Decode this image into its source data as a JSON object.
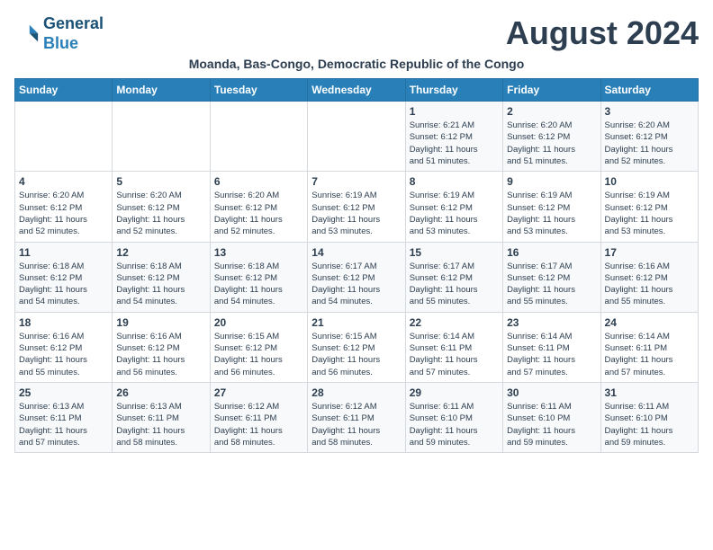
{
  "header": {
    "logo_line1": "General",
    "logo_line2": "Blue",
    "month_title": "August 2024",
    "subtitle": "Moanda, Bas-Congo, Democratic Republic of the Congo"
  },
  "days_of_week": [
    "Sunday",
    "Monday",
    "Tuesday",
    "Wednesday",
    "Thursday",
    "Friday",
    "Saturday"
  ],
  "weeks": [
    [
      {
        "day": "",
        "info": ""
      },
      {
        "day": "",
        "info": ""
      },
      {
        "day": "",
        "info": ""
      },
      {
        "day": "",
        "info": ""
      },
      {
        "day": "1",
        "info": "Sunrise: 6:21 AM\nSunset: 6:12 PM\nDaylight: 11 hours\nand 51 minutes."
      },
      {
        "day": "2",
        "info": "Sunrise: 6:20 AM\nSunset: 6:12 PM\nDaylight: 11 hours\nand 51 minutes."
      },
      {
        "day": "3",
        "info": "Sunrise: 6:20 AM\nSunset: 6:12 PM\nDaylight: 11 hours\nand 52 minutes."
      }
    ],
    [
      {
        "day": "4",
        "info": "Sunrise: 6:20 AM\nSunset: 6:12 PM\nDaylight: 11 hours\nand 52 minutes."
      },
      {
        "day": "5",
        "info": "Sunrise: 6:20 AM\nSunset: 6:12 PM\nDaylight: 11 hours\nand 52 minutes."
      },
      {
        "day": "6",
        "info": "Sunrise: 6:20 AM\nSunset: 6:12 PM\nDaylight: 11 hours\nand 52 minutes."
      },
      {
        "day": "7",
        "info": "Sunrise: 6:19 AM\nSunset: 6:12 PM\nDaylight: 11 hours\nand 53 minutes."
      },
      {
        "day": "8",
        "info": "Sunrise: 6:19 AM\nSunset: 6:12 PM\nDaylight: 11 hours\nand 53 minutes."
      },
      {
        "day": "9",
        "info": "Sunrise: 6:19 AM\nSunset: 6:12 PM\nDaylight: 11 hours\nand 53 minutes."
      },
      {
        "day": "10",
        "info": "Sunrise: 6:19 AM\nSunset: 6:12 PM\nDaylight: 11 hours\nand 53 minutes."
      }
    ],
    [
      {
        "day": "11",
        "info": "Sunrise: 6:18 AM\nSunset: 6:12 PM\nDaylight: 11 hours\nand 54 minutes."
      },
      {
        "day": "12",
        "info": "Sunrise: 6:18 AM\nSunset: 6:12 PM\nDaylight: 11 hours\nand 54 minutes."
      },
      {
        "day": "13",
        "info": "Sunrise: 6:18 AM\nSunset: 6:12 PM\nDaylight: 11 hours\nand 54 minutes."
      },
      {
        "day": "14",
        "info": "Sunrise: 6:17 AM\nSunset: 6:12 PM\nDaylight: 11 hours\nand 54 minutes."
      },
      {
        "day": "15",
        "info": "Sunrise: 6:17 AM\nSunset: 6:12 PM\nDaylight: 11 hours\nand 55 minutes."
      },
      {
        "day": "16",
        "info": "Sunrise: 6:17 AM\nSunset: 6:12 PM\nDaylight: 11 hours\nand 55 minutes."
      },
      {
        "day": "17",
        "info": "Sunrise: 6:16 AM\nSunset: 6:12 PM\nDaylight: 11 hours\nand 55 minutes."
      }
    ],
    [
      {
        "day": "18",
        "info": "Sunrise: 6:16 AM\nSunset: 6:12 PM\nDaylight: 11 hours\nand 55 minutes."
      },
      {
        "day": "19",
        "info": "Sunrise: 6:16 AM\nSunset: 6:12 PM\nDaylight: 11 hours\nand 56 minutes."
      },
      {
        "day": "20",
        "info": "Sunrise: 6:15 AM\nSunset: 6:12 PM\nDaylight: 11 hours\nand 56 minutes."
      },
      {
        "day": "21",
        "info": "Sunrise: 6:15 AM\nSunset: 6:12 PM\nDaylight: 11 hours\nand 56 minutes."
      },
      {
        "day": "22",
        "info": "Sunrise: 6:14 AM\nSunset: 6:11 PM\nDaylight: 11 hours\nand 57 minutes."
      },
      {
        "day": "23",
        "info": "Sunrise: 6:14 AM\nSunset: 6:11 PM\nDaylight: 11 hours\nand 57 minutes."
      },
      {
        "day": "24",
        "info": "Sunrise: 6:14 AM\nSunset: 6:11 PM\nDaylight: 11 hours\nand 57 minutes."
      }
    ],
    [
      {
        "day": "25",
        "info": "Sunrise: 6:13 AM\nSunset: 6:11 PM\nDaylight: 11 hours\nand 57 minutes."
      },
      {
        "day": "26",
        "info": "Sunrise: 6:13 AM\nSunset: 6:11 PM\nDaylight: 11 hours\nand 58 minutes."
      },
      {
        "day": "27",
        "info": "Sunrise: 6:12 AM\nSunset: 6:11 PM\nDaylight: 11 hours\nand 58 minutes."
      },
      {
        "day": "28",
        "info": "Sunrise: 6:12 AM\nSunset: 6:11 PM\nDaylight: 11 hours\nand 58 minutes."
      },
      {
        "day": "29",
        "info": "Sunrise: 6:11 AM\nSunset: 6:10 PM\nDaylight: 11 hours\nand 59 minutes."
      },
      {
        "day": "30",
        "info": "Sunrise: 6:11 AM\nSunset: 6:10 PM\nDaylight: 11 hours\nand 59 minutes."
      },
      {
        "day": "31",
        "info": "Sunrise: 6:11 AM\nSunset: 6:10 PM\nDaylight: 11 hours\nand 59 minutes."
      }
    ]
  ]
}
